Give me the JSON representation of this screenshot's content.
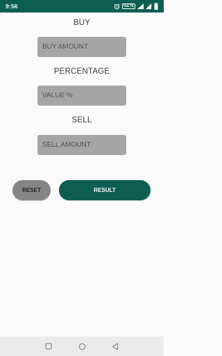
{
  "status_bar": {
    "time": "9:56",
    "volte": "VoLTE",
    "bg_color": "#0d5e52",
    "icons": [
      "alarm-icon",
      "volte-icon",
      "wifi-icon",
      "signal-icon",
      "battery-icon"
    ]
  },
  "form": {
    "buy_label": "BUY",
    "buy_placeholder": "BUY AMOUNT",
    "percentage_label": "PERCENTAGE",
    "percentage_placeholder": "VALUE %",
    "sell_label": "SELL",
    "sell_placeholder": "SELL AMOUNT"
  },
  "buttons": {
    "reset_label": "RESET",
    "result_label": "RESULT",
    "result_color": "#0d5e52",
    "reset_color": "#858585"
  },
  "nav_bar": {
    "icons": [
      "recents-square-icon",
      "home-circle-icon",
      "back-triangle-icon"
    ]
  }
}
